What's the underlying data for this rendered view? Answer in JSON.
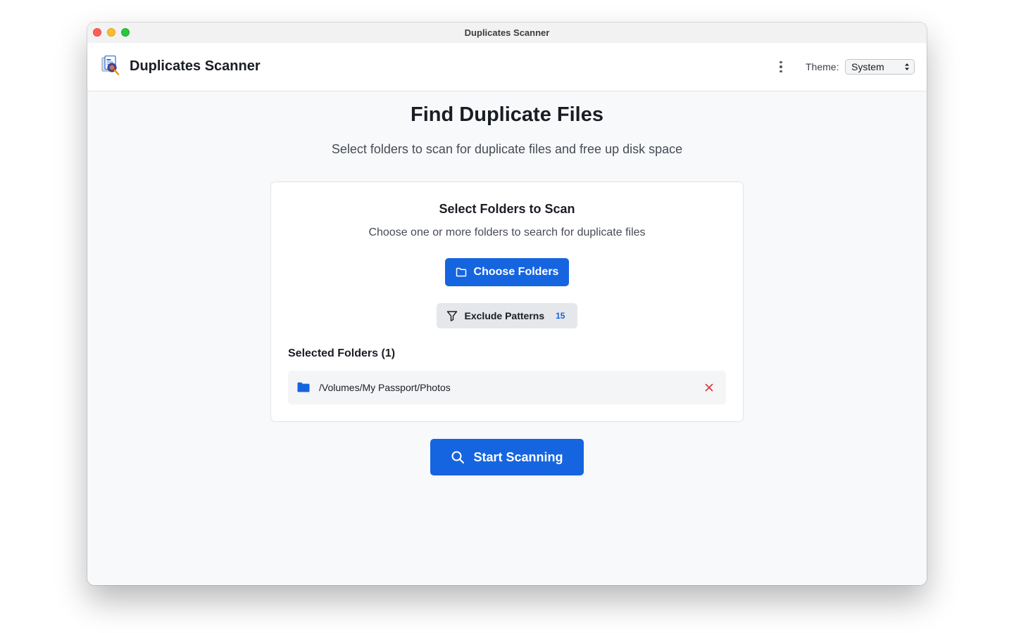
{
  "window": {
    "title": "Duplicates Scanner"
  },
  "header": {
    "app_name": "Duplicates Scanner",
    "logo_icon": "duplicate-files-magnifier-icon",
    "menu_icon": "more-vertical-icon",
    "theme_label": "Theme:",
    "theme_value": "System"
  },
  "main": {
    "title": "Find Duplicate Files",
    "subtitle": "Select folders to scan for duplicate files and free up disk space"
  },
  "card": {
    "title": "Select Folders to Scan",
    "description": "Choose one or more folders to search for duplicate files",
    "choose_button": {
      "label": "Choose Folders",
      "icon": "folder-outline-icon"
    },
    "exclude_button": {
      "label": "Exclude Patterns",
      "icon": "filter-icon",
      "count": "15"
    },
    "selected_heading": "Selected Folders (1)",
    "folders": [
      {
        "path": "/Volumes/My Passport/Photos",
        "icon": "folder-filled-icon",
        "remove_icon": "close-icon"
      }
    ]
  },
  "start_button": {
    "label": "Start Scanning",
    "icon": "search-icon"
  },
  "colors": {
    "accent": "#1565e0",
    "remove": "#d93636",
    "text_primary": "#1a1d24",
    "text_secondary": "#464b55"
  }
}
